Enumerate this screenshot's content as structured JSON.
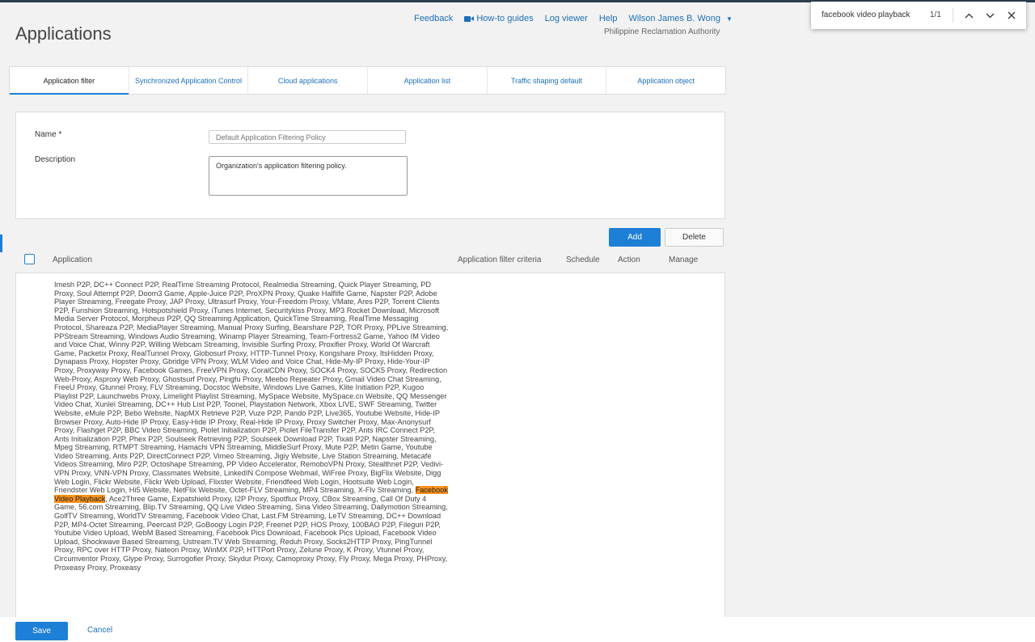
{
  "header": {
    "title": "Applications",
    "links": [
      "Feedback",
      "How-to guides",
      "Log viewer",
      "Help"
    ],
    "user": "Wilson James B. Wong",
    "organization": "Philippine Reclamation Authority"
  },
  "find_bar": {
    "query": "facebook video playback",
    "count": "1/1"
  },
  "tabs": [
    "Application filter",
    "Synchronized Application Control",
    "Cloud applications",
    "Application list",
    "Traffic shaping default",
    "Application object"
  ],
  "form": {
    "name_label": "Name *",
    "name_placeholder": "Default Application Filtering Policy",
    "description_label": "Description",
    "description_value": "Organization's application filtering policy."
  },
  "toolbar": {
    "add_label": "Add",
    "delete_label": "Delete"
  },
  "table": {
    "columns": {
      "application": "Application",
      "criteria": "Application filter criteria",
      "schedule": "Schedule",
      "action": "Action",
      "manage": "Manage"
    },
    "row": {
      "text_before": "Imesh P2P, DC++ Connect P2P, RealTime Streaming Protocol, Realmedia Streaming, Quick Player Streaming, PD Proxy, Soul Attempt P2P, Doom3 Game, Apple-Juice P2P, ProXPN Proxy, Quake Halflife Game, Napster P2P, Adobe Player Streaming, Freegate Proxy, JAP Proxy, Ultrasurf Proxy, Your-Freedom Proxy, VMate, Ares P2P, Torrent Clients P2P, Funshion Streaming, Hotspotshield Proxy, iTunes Internet, Securitykiss Proxy, MP3 Rocket Download, Microsoft Media Server Protocol, Morpheus P2P, QQ Streaming Application, QuickTime Streaming, RealTime Messaging Protocol, Shareaza P2P, MediaPlayer Streaming, Manual Proxy Surfing, Bearshare P2P, TOR Proxy, PPLive Streaming, PPStream Streaming, Windows Audio Streaming, Winamp Player Streaming, Team-Fortress2 Game, Yahoo IM Video and Voice Chat, Winny P2P, Willing Webcam Streaming, Invisible Surfing Proxy, Proxifier Proxy, World Of Warcraft Game, Packetix Proxy, RealTunnel Proxy, Globosurf Proxy, HTTP-Tunnel Proxy, Kongshare Proxy, ItsHidden Proxy, Dynapass Proxy, Hopster Proxy, Gbridge VPN Proxy, WLM Video and Voice Chat, Hide-My-IP Proxy, Hide-Your-IP Proxy, Proxyway Proxy, Facebook Games, FreeVPN Proxy, CoralCDN Proxy, SOCK4 Proxy, SOCK5 Proxy, Redirection Web-Proxy, Asproxy Web Proxy, Ghostsurf Proxy, Pingfu Proxy, Meebo Repeater Proxy, Gmail Video Chat Streaming, FreeU Proxy, Gtunnel Proxy, FLV Streaming, Docstoc Website, Windows Live Games, Klite Initiation P2P, Kugoo Playlist P2P, Launchwebs Proxy, Limelight Playlist Streaming, MySpace Website, MySpace.cn Website, QQ Messenger Video Chat, Xunlei Streaming, DC++ Hub List P2P, Toonel, Playstation Network, Xbox LIVE, SWF Streaming, Twitter Website, eMule P2P, Bebo Website, NapMX Retrieve P2P, Vuze P2P, Pando P2P, Live365, Youtube Website, Hide-IP Browser Proxy, Auto-Hide IP Proxy, Easy-Hide IP Proxy, Real-Hide IP Proxy, Proxy Switcher Proxy, Max-Anonysurf Proxy, Flashget P2P, BBC Video Streaming, Piolet Initialization P2P, Piolet FileTransfer P2P, Ants IRC Connect P2P, Ants Initialization P2P, Phex P2P, Soulseek Retrieving P2P, Soulseek Download P2P, Tixati P2P, Napster Streaming, Mpeg Streaming, RTMPT Streaming, Hamachi VPN Streaming, MiddleSurf Proxy, Mute P2P, Metin Game, Youtube Video Streaming, Ants P2P, DirectConnect P2P, Vimeo Streaming, Jigiy Website, Live Station Streaming, Metacafe Videos Streaming, Miro P2P, Octoshape Streaming, PP Video Accelerator, RemoboVPN Proxy, Stealthnet P2P, Vedivi-VPN Proxy, VNN-VPN Proxy, Classmates Website, LinkedIN Compose Webmail, WiFree Proxy, BigFlix Website, Digg Web Login, Flickr Website, Flickr Web Upload, Flixster Website, Friendfeed Web Login, Hootsuite Web Login, Friendster Web Login, Hi5 Website, NetFlix Website, Octet-FLV Streaming, MP4 Streaming, X-Flv Streaming, ",
      "highlight": "Facebook Video Playback",
      "text_after": ", Ace2Three Game, Expatshield Proxy, I2P Proxy, Spotflux Proxy, CBox Streaming, Call Of Duty 4 Game, 56.com Streaming, Blip.TV Streaming, QQ Live Video Streaming, Sina Video Streaming, Dailymotion Streaming, GolfTV Streaming, WorldTV Streaming, Facebook Video Chat, Last.FM Streaming, LeTV Streaming, DC++ Download P2P, MP4-Octet Streaming, Peercast P2P, GoBoogy Login P2P, Freenet P2P, HOS Proxy, 100BAO P2P, Fileguri P2P, Youtube Video Upload, WebM Based Streaming, Facebook Pics Download, Facebook Pics Upload, Facebook Video Upload, Shockwave Based Streaming, Ustream.TV Web Streaming, Reduh Proxy, Socks2HTTP Proxy, PingTunnel Proxy, RPC over HTTP Proxy, Nateon Proxy, WinMX P2P, HTTPort Proxy, Zelune Proxy, K Proxy, Vtunnel Proxy, Circumventor Proxy, Glype Proxy, Surrogofier Proxy, Skydur Proxy, Camoproxy Proxy, Fly Proxy, Mega Proxy, PHProxy, Proxeasy Proxy, Proxeasy"
    }
  },
  "footer": {
    "save_label": "Save",
    "cancel_label": "Cancel"
  },
  "colors": {
    "accent": "#1d7fd6",
    "highlight": "#f7931e",
    "link": "#1d6fb8"
  }
}
